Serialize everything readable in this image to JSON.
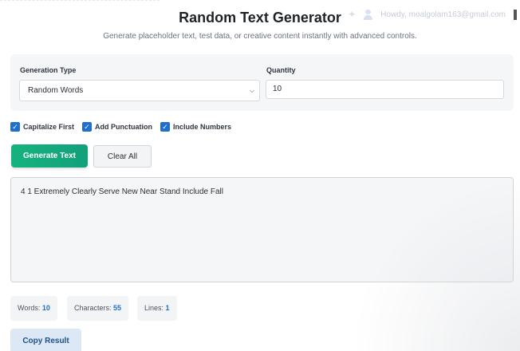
{
  "header": {
    "title": "Random Text Generator",
    "subtitle": "Generate placeholder text, test data, or creative content instantly with advanced controls.",
    "account_text": "Howdy, moalgolam163@gmail.com"
  },
  "form": {
    "generation_type_label": "Generation Type",
    "generation_type_value": "Random Words",
    "quantity_label": "Quantity",
    "quantity_value": "10"
  },
  "options": [
    {
      "label": "Capitalize First",
      "checked": true
    },
    {
      "label": "Add Punctuation",
      "checked": true
    },
    {
      "label": "Include Numbers",
      "checked": true
    }
  ],
  "buttons": {
    "generate": "Generate Text",
    "clear": "Clear All",
    "copy": "Copy Result"
  },
  "output": {
    "text": "4 1 Extremely Clearly Serve New Near Stand Include Fall"
  },
  "stats": {
    "words_label": "Words:",
    "words_value": "10",
    "characters_label": "Characters:",
    "characters_value": "55",
    "lines_label": "Lines:",
    "lines_value": "1"
  },
  "colors": {
    "accent_blue": "#1f6fd1",
    "generate_green": "#16b37e",
    "copy_bg": "#dce8f6"
  },
  "icons": [
    "sparkle-icon",
    "user-icon",
    "chevron-down-icon",
    "checkbox-checked-icon"
  ]
}
